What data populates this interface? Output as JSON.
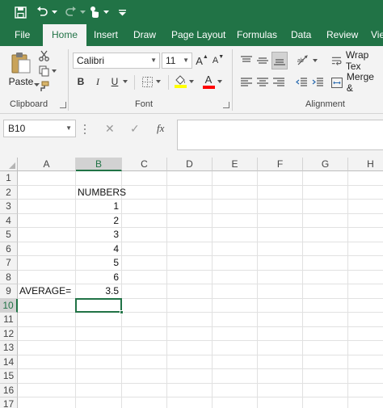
{
  "quick_access": {
    "save_icon": "save-icon",
    "undo_icon": "undo-icon",
    "redo_icon": "redo-icon",
    "touch_icon": "touch-mode-icon",
    "customize_icon": "customize-icon"
  },
  "tabs": [
    {
      "label": "File",
      "active": false
    },
    {
      "label": "Home",
      "active": true
    },
    {
      "label": "Insert",
      "active": false
    },
    {
      "label": "Draw",
      "active": false
    },
    {
      "label": "Page Layout",
      "active": false
    },
    {
      "label": "Formulas",
      "active": false
    },
    {
      "label": "Data",
      "active": false
    },
    {
      "label": "Review",
      "active": false
    },
    {
      "label": "Vie",
      "active": false
    }
  ],
  "ribbon": {
    "clipboard": {
      "paste_label": "Paste",
      "group_label": "Clipboard"
    },
    "font": {
      "font_name": "Calibri",
      "font_size": "11",
      "grow_label": "A",
      "shrink_label": "A",
      "bold": "B",
      "italic": "I",
      "underline": "U",
      "font_color_label": "A",
      "group_label": "Font",
      "highlight_color": "#ffff00",
      "font_color": "#ff0000"
    },
    "alignment": {
      "wrap_text": "Wrap Tex",
      "merge": "Merge &",
      "group_label": "Alignment"
    }
  },
  "formula_bar": {
    "name_box": "B10",
    "cancel_symbol": "✕",
    "enter_symbol": "✓",
    "fx_label": "fx",
    "formula": ""
  },
  "sheet": {
    "columns": [
      "A",
      "B",
      "C",
      "D",
      "E",
      "F",
      "G",
      "H"
    ],
    "rows": [
      "1",
      "2",
      "3",
      "4",
      "5",
      "6",
      "7",
      "8",
      "9",
      "10",
      "11",
      "12",
      "13",
      "14",
      "15",
      "16",
      "17"
    ],
    "selected_column": "B",
    "selected_row": "10",
    "cells": {
      "B2": "NUMBERS",
      "B3": "1",
      "B4": "2",
      "B5": "3",
      "B6": "4",
      "B7": "5",
      "B8": "6",
      "A9": "AVERAGE=",
      "B9": "3.5"
    }
  },
  "colors": {
    "brand": "#217346",
    "ribbon_bg": "#f3f3f3"
  }
}
